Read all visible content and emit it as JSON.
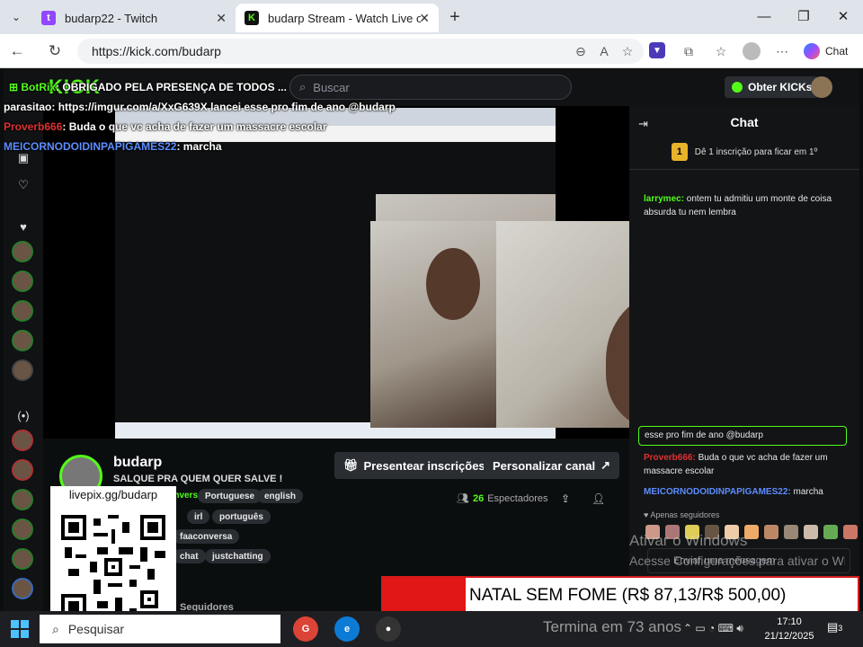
{
  "browser": {
    "tabs": [
      {
        "title": "budarp22 - Twitch",
        "favicon": "twitch-icon"
      },
      {
        "title": "budarp Stream - Watch Live on Kick",
        "favicon": "kick-icon"
      }
    ],
    "url": "https://kick.com/budarp",
    "chat_button": "Chat"
  },
  "kick": {
    "logo": "KICK",
    "search_placeholder": "Buscar",
    "obter_kicks": "Obter KICKs",
    "streamer": {
      "name": "budarp",
      "title": "SALQUE PRA QUEM QUER SALVE !",
      "category": "Conversa",
      "tags_row1": [
        "Portuguese",
        "english"
      ],
      "tags_row2": [
        "irl",
        "português"
      ],
      "tags_row3": [
        "faaconversa"
      ],
      "tags_row4": [
        "chat",
        "justchatting"
      ],
      "followers": "Seguidores",
      "viewers_count": "26",
      "viewers_label": "Espectadores"
    },
    "buttons": {
      "gift": "Presentear inscrições",
      "customize": "Personalizar canal"
    }
  },
  "overlay_chat": [
    {
      "user": "BotRix",
      "text": ": OBRIGADO PELA PRESENÇA DE TODOS ...",
      "color": "#53fc18"
    },
    {
      "user": "parasitao",
      "text": ": https://imgur.com/a/XxG639X lancei esse pro fim de ano @budarp",
      "color": "#ffffff"
    },
    {
      "user": "Proverb666",
      "text": ": Buda o que vc acha de fazer um massacre escolar",
      "color": "#e03030"
    },
    {
      "user": "MEICORNODOIDINPAPIGAMES22",
      "text": ": marcha",
      "color": "#5d8dff"
    }
  ],
  "chat": {
    "title": "Chat",
    "sub_banner": "Dê 1 inscrição para ficar em 1º",
    "messages": [
      {
        "user": "larrymec:",
        "text": " ontem tu admitiu um monte de coisa absurda tu nem lembra",
        "color": "#53fc18"
      },
      {
        "user": "",
        "text": "esse pro fim de ano @budarp",
        "color": "#ffffff"
      },
      {
        "user": "Proverb666:",
        "text": " Buda o que vc acha de fazer um massacre escolar",
        "color": "#e03030"
      },
      {
        "user": "MEICORNODOIDINPAPIGAMES22:",
        "text": " marcha",
        "color": "#5d8dff"
      }
    ],
    "followers_only": "Apenas seguidores",
    "input_placeholder": "Enviar uma mensagem"
  },
  "qr": {
    "label": "livepix.gg/budarp"
  },
  "natal_bar": {
    "text": "NATAL SEM FOME (R$ 87,13/R$ 500,00)",
    "progress": 0.1743
  },
  "watermark": {
    "line1": "Ativar o Windows",
    "line2": "Acesse Configurações para ativar o Windows."
  },
  "taskbar": {
    "search": "Pesquisar",
    "termina": "Termina em 73 anos",
    "time": "17:10",
    "date": "21/12/2025",
    "notif": "3"
  }
}
